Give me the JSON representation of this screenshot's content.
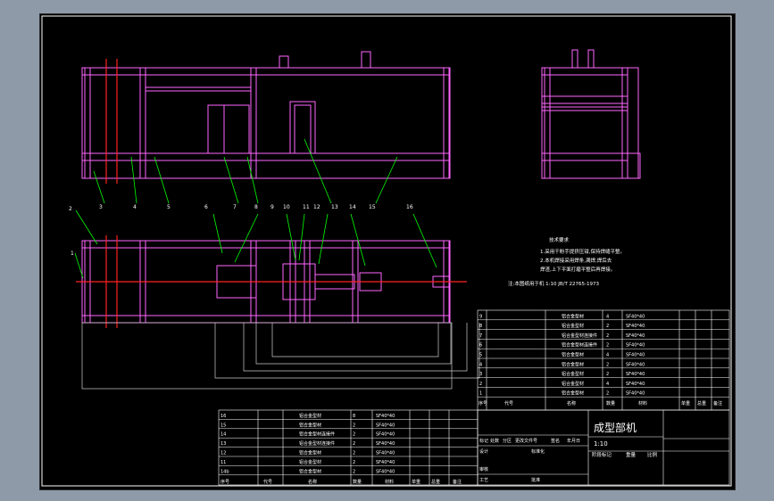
{
  "drawing": {
    "title": "成型部机",
    "scale_text": "1:10",
    "weight_label": "重量",
    "ratio_label": "比例",
    "stage_label": "阶段标记",
    "scale_row_label": "比例",
    "tech_requirements": {
      "heading": "技术要求",
      "lines": [
        "1.采用干粉手提挤压钳,保持焊缝平整。",
        "2.本机焊接采用焊条,满焊,焊后去",
        "  焊渣,上下平面打磨平整后再焊接。"
      ],
      "note": "注:本图纸用于机 1:10 JB/T 22765-1973"
    },
    "balloons": [
      "1",
      "2",
      "3",
      "4",
      "5",
      "6",
      "7",
      "8",
      "9",
      "10",
      "11",
      "12",
      "13",
      "14",
      "15",
      "16"
    ],
    "parts_upper": [
      {
        "no": "9",
        "name": "铝合金型材",
        "qty": "4",
        "spec": "SF40*40"
      },
      {
        "no": "8",
        "name": "铝合金型材",
        "qty": "2",
        "spec": "SF40*40"
      },
      {
        "no": "7",
        "name": "铝合金型材连接件",
        "qty": "2",
        "spec": "SF40*40"
      },
      {
        "no": "6",
        "name": "铝合金型材连接件",
        "qty": "2",
        "spec": "SF40*40"
      },
      {
        "no": "5",
        "name": "铝合金型材",
        "qty": "4",
        "spec": "SF40*40"
      },
      {
        "no": "4",
        "name": "铝合金型材",
        "qty": "2",
        "spec": "SF40*40"
      },
      {
        "no": "3",
        "name": "铝合金型材",
        "qty": "2",
        "spec": "SF40*40"
      },
      {
        "no": "2",
        "name": "铝合金型材",
        "qty": "4",
        "spec": "SF40*40"
      },
      {
        "no": "1",
        "name": "铝合金型材",
        "qty": "2",
        "spec": "SF40*40"
      }
    ],
    "parts_lower": [
      {
        "no": "16",
        "name": "铝合金型材",
        "qty": "8",
        "spec": "SF40*40"
      },
      {
        "no": "15",
        "name": "铝合金型材",
        "qty": "2",
        "spec": "SF40*40"
      },
      {
        "no": "14",
        "name": "铝合金型材连接件",
        "qty": "2",
        "spec": "SF40*40"
      },
      {
        "no": "13",
        "name": "铝合金型材连接件",
        "qty": "2",
        "spec": "SF40*40"
      },
      {
        "no": "12",
        "name": "铝合金型材",
        "qty": "2",
        "spec": "SF40*40"
      },
      {
        "no": "11",
        "name": "铝合金型材",
        "qty": "2",
        "spec": "SF40*40"
      },
      {
        "no": "14b",
        "name": "铝合金型材",
        "qty": "2",
        "spec": "SF40*40"
      }
    ],
    "header_cols": [
      "序号",
      "代号",
      "名称",
      "数量",
      "材料",
      "单重",
      "总重",
      "备注"
    ],
    "title_block_labels": [
      "标记",
      "处数",
      "分区",
      "更改文件号",
      "签名",
      "年月日",
      "设计",
      "标准化",
      "审核",
      "工艺",
      "批准"
    ]
  }
}
